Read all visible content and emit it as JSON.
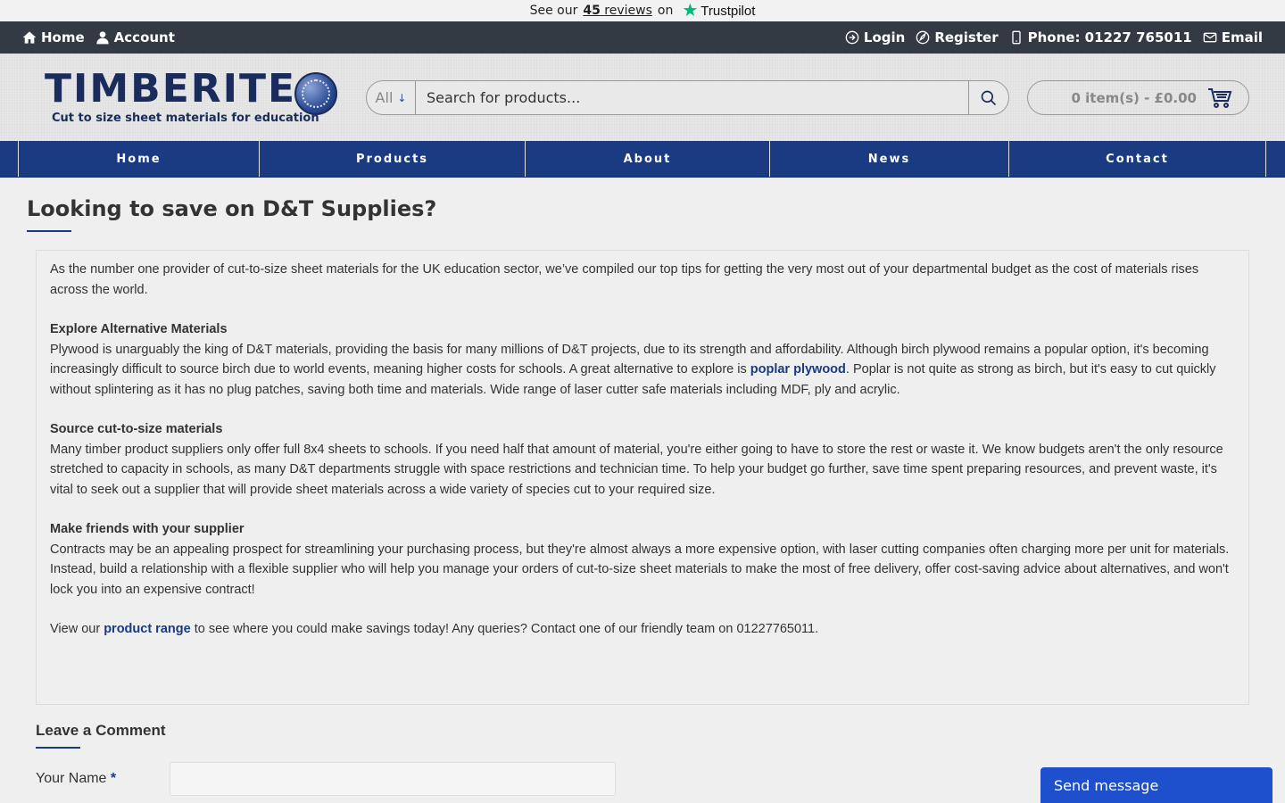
{
  "trustbar": {
    "prefix": "See our",
    "count": "45",
    "reviews": "reviews",
    "on": "on",
    "brand": "Trustpilot"
  },
  "topbar": {
    "home": "Home",
    "account": "Account",
    "login": "Login",
    "register": "Register",
    "phone": "Phone: 01227 765011",
    "email": "Email"
  },
  "logo": {
    "brand": "TIMBERITE",
    "tagline": "Cut to size sheet materials for education"
  },
  "search": {
    "category": "All",
    "placeholder": "Search for products..."
  },
  "cart": {
    "summary": "0 item(s) - £0.00"
  },
  "nav": {
    "items": [
      "Home",
      "Products",
      "About",
      "News",
      "Contact"
    ]
  },
  "page": {
    "title": "Looking to save on D&T Supplies?"
  },
  "article": {
    "intro": "As the number one provider of cut-to-size sheet materials for the UK education sector, we’ve compiled our top tips for getting the very most out of your departmental budget as the cost of materials rises across the world.",
    "s1_heading": "Explore Alternative Materials",
    "s1_text_a": "Plywood is unarguably the king of D&T materials, providing the basis for many millions of D&T projects, due to its strength and affordability. Although birch plywood remains a popular option, it's becoming increasingly difficult to source birch due to world events, meaning higher costs for schools. A great alternative to explore is ",
    "s1_link": "poplar plywood",
    "s1_text_b": ". Poplar is not quite as strong as birch, but it's easy to cut quickly without splintering as it has no plug patches, saving both time and materials. Wide range of laser cutter safe materials including MDF, ply and acrylic.",
    "s2_heading": "Source cut-to-size materials",
    "s2_text": "Many timber product suppliers only offer full 8x4 sheets to schools. If you need half that amount of material, you're either going to have to store the rest or waste it. We know budgets aren't the only resource stretched to capacity in schools, as many D&T departments struggle with space restrictions and technician time. To help your budget go further, save time spent preparing resources, and prevent waste, it's vital to seek out a supplier that will provide sheet materials across a wide variety of species cut to your required size.",
    "s3_heading": "Make friends with your supplier",
    "s3_text": "Contracts may be an appealing prospect for streamlining your purchasing process, but they're almost always a more expensive option, with laser cutting companies often charging more per unit for materials. Instead, build a relationship with a flexible supplier who will help you manage your orders of cut-to-size sheet materials to make the most of free delivery, offer cost-saving advice about alternatives, and won't lock you into an expensive contract!",
    "cta_a": "View our ",
    "cta_link": "product range",
    "cta_b": " to see where you could make savings today!  Any queries?  Contact one of our friendly team on 01227765011."
  },
  "comment": {
    "heading": "Leave a Comment",
    "name_label": "Your Name",
    "required_mark": "*"
  },
  "chat": {
    "label": "Send message"
  },
  "colors": {
    "brand_navy": "#1a2c5b",
    "nav_blue": "#1a3a82",
    "topbar": "#333a44",
    "chat_blue": "#1e4fcc",
    "trustpilot_green": "#00b67a"
  }
}
